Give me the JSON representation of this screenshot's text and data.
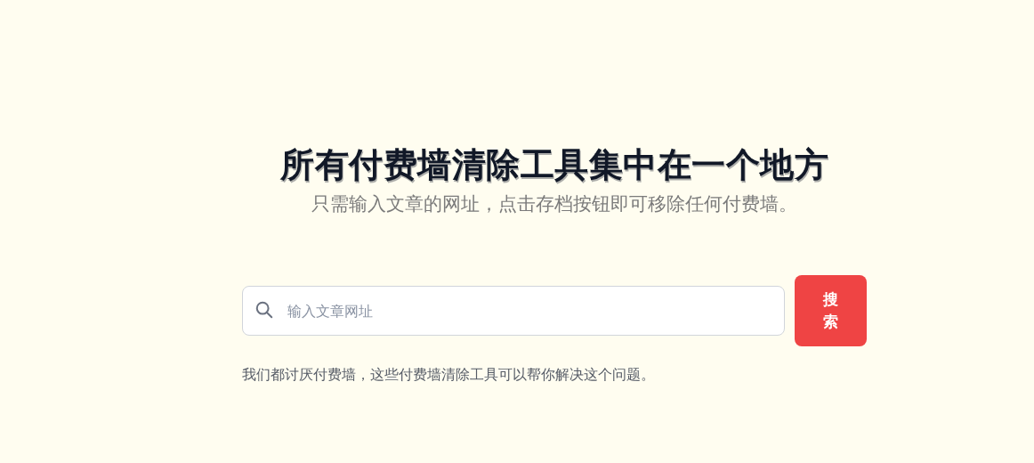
{
  "hero": {
    "title": "所有付费墙清除工具集中在一个地方",
    "subtitle": "只需输入文章的网址，点击存档按钮即可移除任何付费墙。"
  },
  "search": {
    "placeholder": "输入文章网址",
    "button": "搜索"
  },
  "note": "我们都讨厌付费墙，这些付费墙清除工具可以帮你解决这个问题。"
}
